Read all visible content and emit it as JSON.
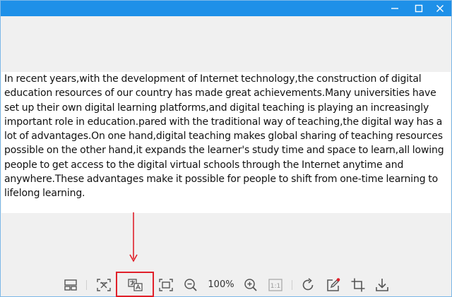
{
  "document": {
    "text": "In recent years,with the development of Internet technology,the construction of digital education resources of our country has made great achievements.Many universities have set up their own digital learning platforms,and digital teaching is playing an increasingly important role in education.pared with the traditional way of teaching,the digital way has a lot of advantages.On one hand,digital teaching makes global sharing of teaching resources possible on the other hand,it expands the learner's study time and space to learn,all lowing people to get access to the digital virtual schools through the Internet anytime and anywhere.These advantages make it possible for people to shift from one-time learning to lifelong learning."
  },
  "toolbar": {
    "zoom_level": "100%",
    "actual_size_label": "1:1"
  },
  "colors": {
    "titlebar": "#1e90e8",
    "highlight": "#e0202a",
    "icon": "#555555"
  }
}
